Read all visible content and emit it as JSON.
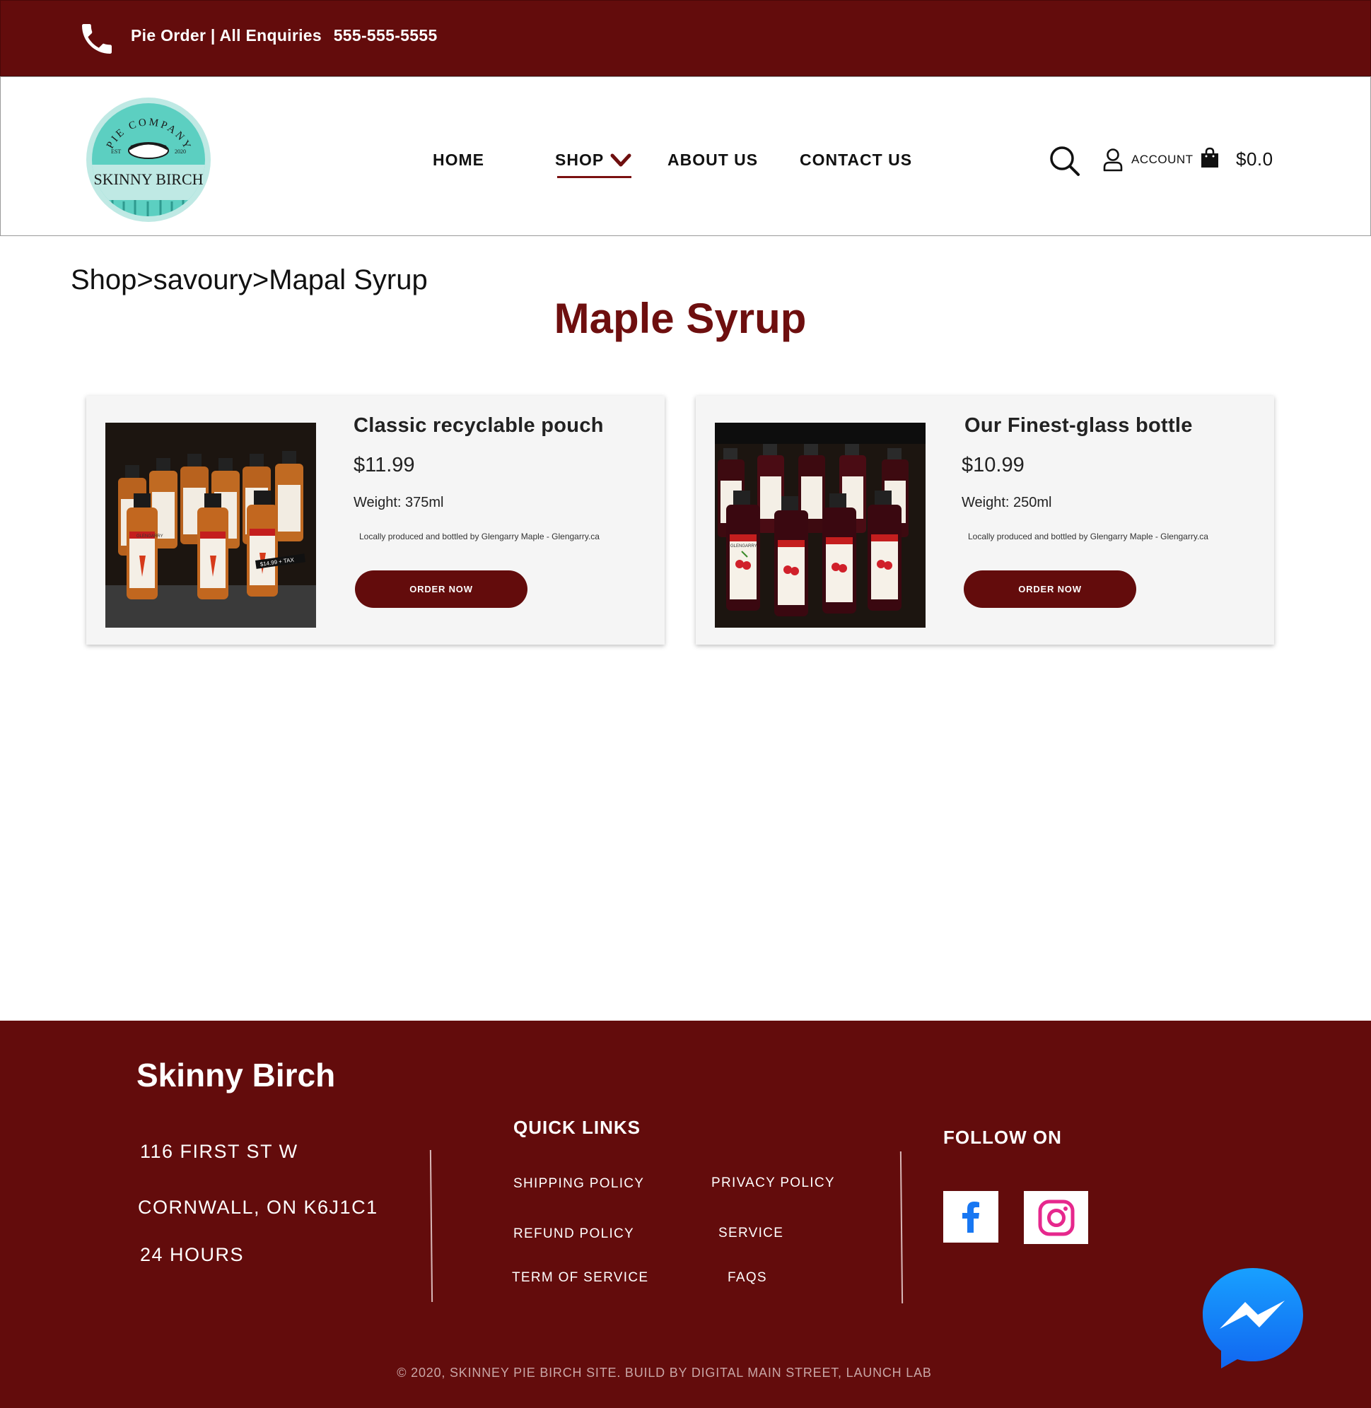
{
  "topbar": {
    "contact_label": "Pie Order | All Enquiries",
    "phone_number": "555-555-5555",
    "phone_icon": "phone-icon"
  },
  "header": {
    "logo": {
      "arc_text": "PIE COMPANY",
      "est_label": "EST",
      "est_year": "2020",
      "brand": "SKINNY BIRCH"
    },
    "nav": {
      "home": "HOME",
      "shop": "SHOP",
      "about": "ABOUT US",
      "contact": "CONTACT US"
    },
    "account_label": "ACCOUNT",
    "cart_total": "$0.0",
    "icons": [
      "search-icon",
      "account-icon",
      "shopping-bag-icon",
      "chevron-down-icon"
    ]
  },
  "breadcrumb": "Shop>savoury>Mapal Syrup",
  "page_title": "Maple Syrup",
  "products": [
    {
      "title": "Classic recyclable pouch",
      "price": "$11.99",
      "weight": "Weight: 375ml",
      "description": "Locally produced and bottled by Glengarry Maple - Glengarry.ca",
      "button": "ORDER NOW",
      "image_label": "GLENGARRY",
      "price_tag": "$14.99 + TAX"
    },
    {
      "title": "Our Finest-glass bottle",
      "price": "$10.99",
      "weight": "Weight: 250ml",
      "description": "Locally produced and bottled by Glengarry Maple - Glengarry.ca",
      "button": "ORDER NOW",
      "image_label": "GLENGARRY"
    }
  ],
  "footer": {
    "brand": "Skinny Birch",
    "address_line1": "116 FIRST ST W",
    "address_line2": "CORNWALL, ON K6J1C1",
    "hours": "24 HOURS",
    "quick_links_heading": "QUICK LINKS",
    "quick_links": {
      "shipping": "SHIPPING POLICY",
      "privacy": "PRIVACY POLICY",
      "refund": "REFUND POLICY",
      "service": "SERVICE",
      "terms": "TERM OF SERVICE",
      "faqs": "FAQS"
    },
    "follow_heading": "FOLLOW ON",
    "copyright": "© 2020, SKINNEY PIE BIRCH SITE. BUILD BY DIGITAL MAIN STREET, LAUNCH LAB"
  },
  "colors": {
    "brand_maroon": "#630c0c",
    "title_maroon": "#6e0f0f",
    "logo_teal": "#5ccfc1",
    "facebook_blue": "#1877f2",
    "instagram_pink": "#e1306c",
    "messenger_blue": "#1d8bff"
  }
}
